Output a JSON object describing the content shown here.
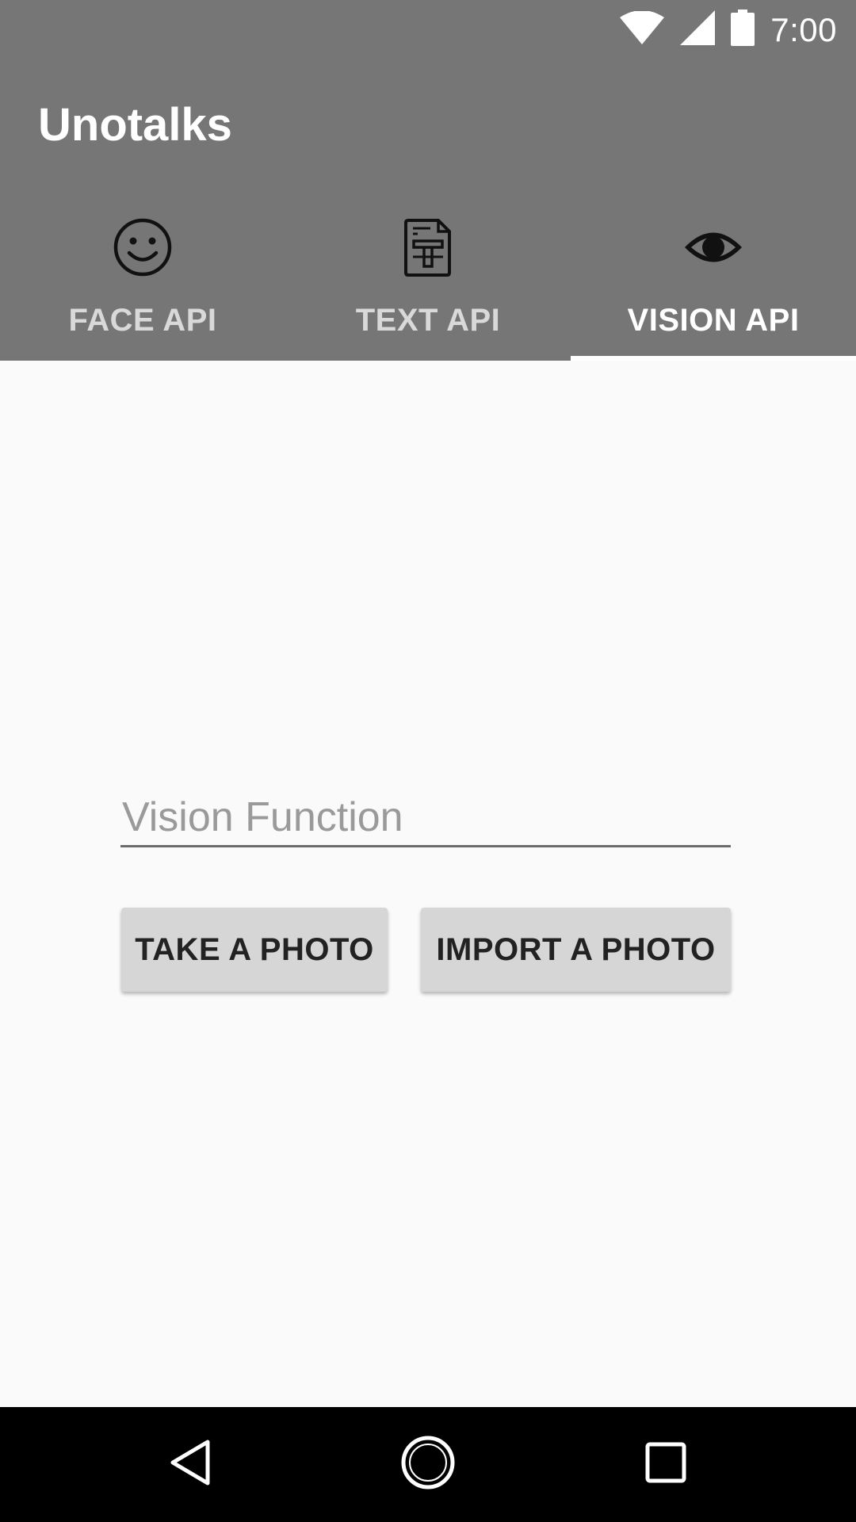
{
  "status_bar": {
    "time": "7:00",
    "icons": [
      "wifi-icon",
      "signal-icon",
      "battery-icon"
    ]
  },
  "app_bar": {
    "title": "Unotalks",
    "background_color": "#767676"
  },
  "tabs": [
    {
      "label": "FACE API",
      "icon": "smiley-face-icon",
      "active": false
    },
    {
      "label": "TEXT API",
      "icon": "text-document-icon",
      "active": false
    },
    {
      "label": "VISION API",
      "icon": "eye-icon",
      "active": true
    }
  ],
  "main": {
    "vision_input": {
      "value": "",
      "placeholder": "Vision Function"
    },
    "take_photo_label": "TAKE A PHOTO",
    "import_photo_label": "IMPORT A PHOTO"
  },
  "nav_bar": {
    "buttons": [
      "back-icon",
      "home-icon",
      "recents-icon"
    ]
  }
}
